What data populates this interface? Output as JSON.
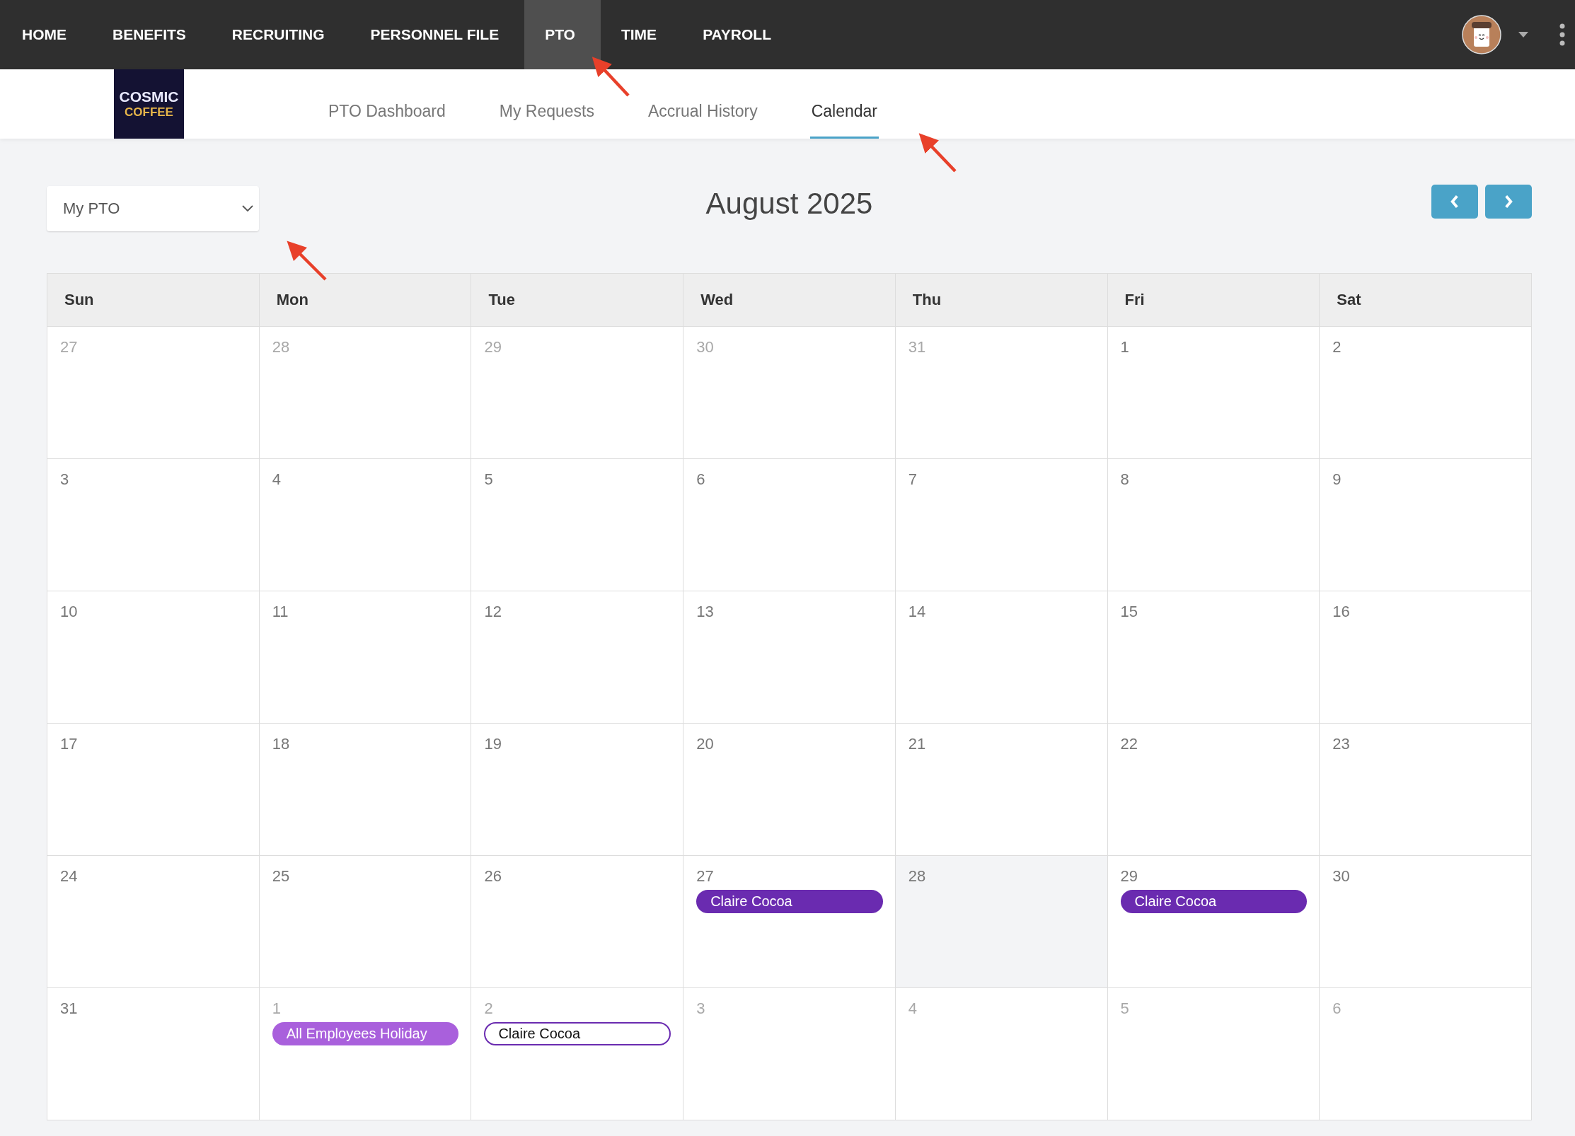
{
  "top_nav": {
    "items": [
      {
        "label": "HOME",
        "selected": false
      },
      {
        "label": "BENEFITS",
        "selected": false
      },
      {
        "label": "RECRUITING",
        "selected": false
      },
      {
        "label": "PERSONNEL FILE",
        "selected": false
      },
      {
        "label": "PTO",
        "selected": true
      },
      {
        "label": "TIME",
        "selected": false
      },
      {
        "label": "PAYROLL",
        "selected": false
      }
    ]
  },
  "logo": {
    "lines": [
      "COSMIC",
      "COFFEE"
    ]
  },
  "sub_nav": {
    "tabs": [
      {
        "label": "PTO Dashboard",
        "selected": false
      },
      {
        "label": "My Requests",
        "selected": false
      },
      {
        "label": "Accrual History",
        "selected": false
      },
      {
        "label": "Calendar",
        "selected": true
      }
    ]
  },
  "filter": {
    "value": "My PTO"
  },
  "calendar": {
    "title": "August 2025",
    "weekdays": [
      "Sun",
      "Mon",
      "Tue",
      "Wed",
      "Thu",
      "Fri",
      "Sat"
    ],
    "weeks": [
      [
        {
          "day": "27",
          "other_month": true
        },
        {
          "day": "28",
          "other_month": true
        },
        {
          "day": "29",
          "other_month": true
        },
        {
          "day": "30",
          "other_month": true
        },
        {
          "day": "31",
          "other_month": true
        },
        {
          "day": "1",
          "other_month": false
        },
        {
          "day": "2",
          "other_month": false
        }
      ],
      [
        {
          "day": "3",
          "other_month": false
        },
        {
          "day": "4",
          "other_month": false
        },
        {
          "day": "5",
          "other_month": false
        },
        {
          "day": "6",
          "other_month": false
        },
        {
          "day": "7",
          "other_month": false
        },
        {
          "day": "8",
          "other_month": false
        },
        {
          "day": "9",
          "other_month": false
        }
      ],
      [
        {
          "day": "10",
          "other_month": false
        },
        {
          "day": "11",
          "other_month": false
        },
        {
          "day": "12",
          "other_month": false
        },
        {
          "day": "13",
          "other_month": false
        },
        {
          "day": "14",
          "other_month": false
        },
        {
          "day": "15",
          "other_month": false
        },
        {
          "day": "16",
          "other_month": false
        }
      ],
      [
        {
          "day": "17",
          "other_month": false
        },
        {
          "day": "18",
          "other_month": false
        },
        {
          "day": "19",
          "other_month": false
        },
        {
          "day": "20",
          "other_month": false
        },
        {
          "day": "21",
          "other_month": false
        },
        {
          "day": "22",
          "other_month": false
        },
        {
          "day": "23",
          "other_month": false
        }
      ],
      [
        {
          "day": "24",
          "other_month": false
        },
        {
          "day": "25",
          "other_month": false
        },
        {
          "day": "26",
          "other_month": false
        },
        {
          "day": "27",
          "other_month": false,
          "events": [
            {
              "label": "Claire Cocoa",
              "kind": "filled",
              "color": "#6a2bb0"
            }
          ]
        },
        {
          "day": "28",
          "other_month": false,
          "today": true
        },
        {
          "day": "29",
          "other_month": false,
          "events": [
            {
              "label": "Claire Cocoa",
              "kind": "filled",
              "color": "#6a2bb0"
            }
          ]
        },
        {
          "day": "30",
          "other_month": false
        }
      ],
      [
        {
          "day": "31",
          "other_month": false
        },
        {
          "day": "1",
          "other_month": true,
          "events": [
            {
              "label": "All Employees Holiday",
              "kind": "filled",
              "color": "#a960dc"
            }
          ]
        },
        {
          "day": "2",
          "other_month": true,
          "events": [
            {
              "label": "Claire Cocoa",
              "kind": "outline",
              "color": "#6a2bb0"
            }
          ]
        },
        {
          "day": "3",
          "other_month": true
        },
        {
          "day": "4",
          "other_month": true
        },
        {
          "day": "5",
          "other_month": true
        },
        {
          "day": "6",
          "other_month": true
        }
      ]
    ]
  }
}
